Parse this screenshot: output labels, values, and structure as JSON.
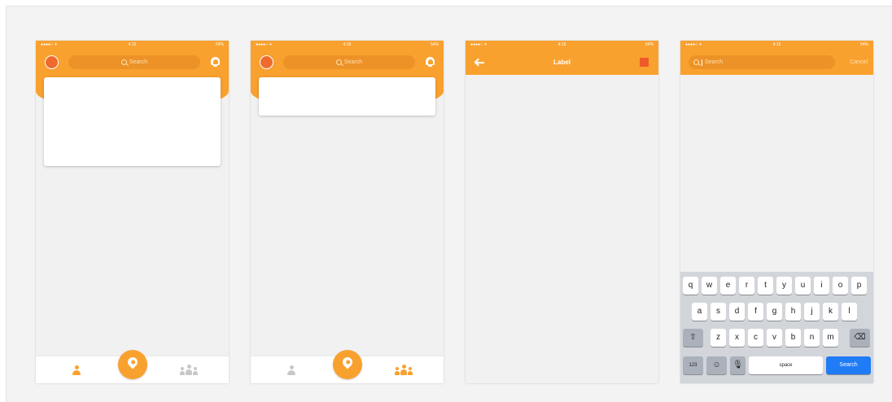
{
  "status": {
    "time": "4:16",
    "battery": "54%"
  },
  "screens": [
    {
      "search_placeholder": "Search"
    },
    {
      "search_placeholder": "Search"
    },
    {
      "title": "Label"
    },
    {
      "search_placeholder": "Search",
      "cancel_label": "Cancel"
    }
  ],
  "keyboard": {
    "row1": [
      "q",
      "w",
      "e",
      "r",
      "t",
      "y",
      "u",
      "i",
      "o",
      "p"
    ],
    "row2": [
      "a",
      "s",
      "d",
      "f",
      "g",
      "h",
      "j",
      "k",
      "l"
    ],
    "row3": [
      "z",
      "x",
      "c",
      "v",
      "b",
      "n",
      "m"
    ],
    "numbers_label": "123",
    "space_label": "space",
    "search_label": "Search"
  },
  "colors": {
    "accent": "#f9a12e",
    "accent_dark": "#ef5a2a",
    "keyboard_blue": "#1f7cf6"
  }
}
